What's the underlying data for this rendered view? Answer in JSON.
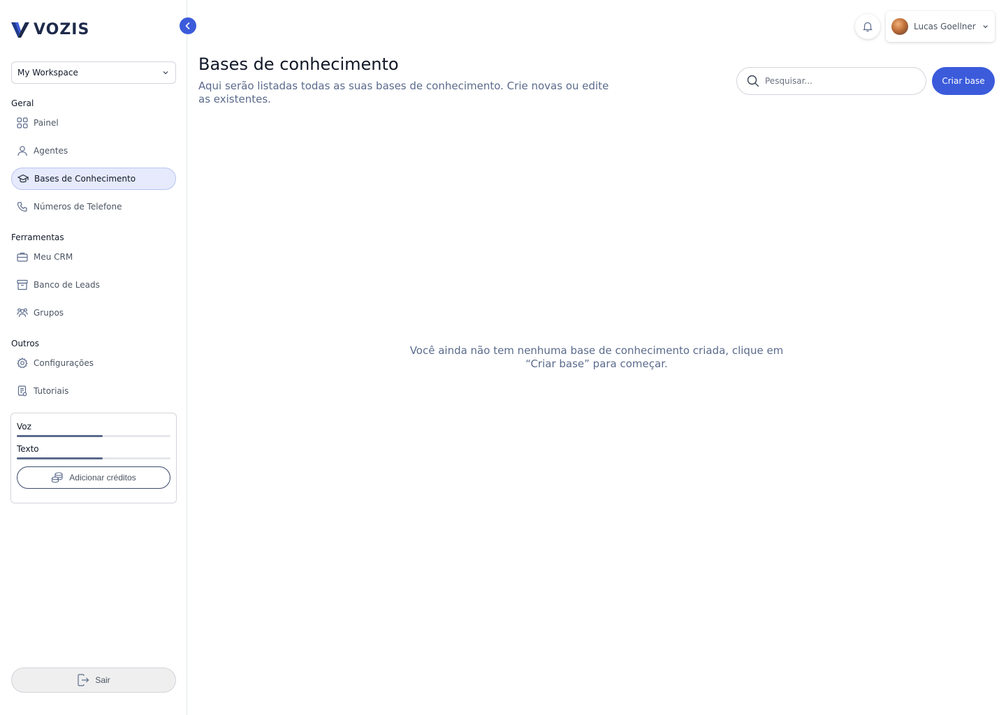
{
  "brand": {
    "name": "VOZIS",
    "accent": "#3b5bdb"
  },
  "workspace": {
    "selected": "My Workspace"
  },
  "nav": {
    "sections": [
      {
        "title": "Geral",
        "items": [
          {
            "label": "Painel",
            "icon": "grid-icon"
          },
          {
            "label": "Agentes",
            "icon": "user-icon"
          },
          {
            "label": "Bases de Conhecimento",
            "icon": "graduation-cap-icon",
            "active": true
          },
          {
            "label": "Números de Telefone",
            "icon": "phone-icon"
          }
        ]
      },
      {
        "title": "Ferramentas",
        "items": [
          {
            "label": "Meu CRM",
            "icon": "briefcase-icon"
          },
          {
            "label": "Banco de Leads",
            "icon": "archive-icon"
          },
          {
            "label": "Grupos",
            "icon": "users-icon"
          }
        ]
      },
      {
        "title": "Outros",
        "items": [
          {
            "label": "Configurações",
            "icon": "gear-icon"
          },
          {
            "label": "Tutoriais",
            "icon": "document-icon"
          }
        ]
      }
    ]
  },
  "credits": {
    "voice_label": "Voz",
    "voice_progress": 0.56,
    "text_label": "Texto",
    "text_progress": 0.56,
    "add_label": "Adicionar créditos"
  },
  "logout_label": "Sair",
  "header": {
    "user_name": "Lucas Goellner"
  },
  "main": {
    "title": "Bases de conhecimento",
    "subtitle": "Aqui serão listadas todas as suas bases de conhecimento. Crie novas ou edite as existentes.",
    "search_placeholder": "Pesquisar...",
    "create_label": "Criar base",
    "empty_message": "Você ainda não tem nenhuma base de conhecimento criada, clique em “Criar base” para começar."
  }
}
